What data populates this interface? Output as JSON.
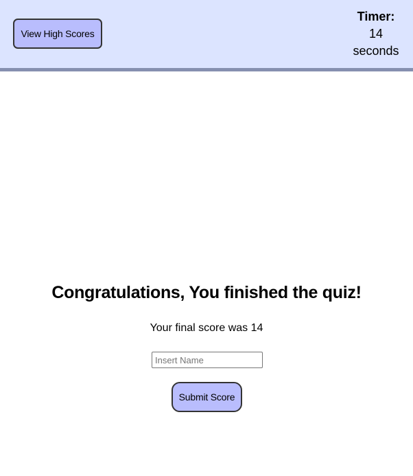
{
  "header": {
    "high_scores_label": "View High Scores",
    "timer_label": "Timer:",
    "timer_value": "14",
    "timer_unit": "seconds"
  },
  "main": {
    "congrats_text": "Congratulations, You finished the quiz!",
    "final_score_text": "Your final score was 14",
    "name_input_placeholder": "Insert Name",
    "name_input_value": "",
    "submit_label": "Submit Score"
  },
  "colors": {
    "header_bg": "#dce4ff",
    "header_border": "#8690b0",
    "button_bg": "#b9bdfd"
  }
}
